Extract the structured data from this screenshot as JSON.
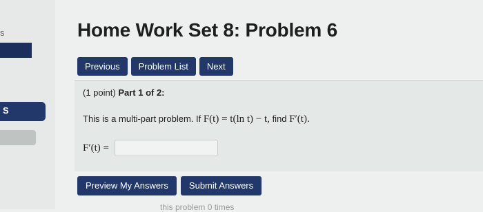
{
  "sidebar": {
    "top_fragment": "s",
    "active_item_label": "S"
  },
  "page": {
    "title": "Home Work Set 8: Problem 6"
  },
  "nav": {
    "previous": "Previous",
    "problem_list": "Problem List",
    "next": "Next"
  },
  "problem": {
    "points": "(1 point)",
    "part": "Part 1 of 2:",
    "text_prefix": "This is a multi-part problem. If",
    "equation": "F(t) = t(ln t) − t,",
    "text_mid": "find",
    "target": "F′(t).",
    "answer_label": "F′(t) =",
    "answer_value": ""
  },
  "actions": {
    "preview": "Preview My Answers",
    "submit": "Submit Answers"
  },
  "footer": {
    "fragment": "this problem 0 times"
  },
  "colors": {
    "button_bg": "#22376a",
    "page_bg": "#eef0ef"
  }
}
